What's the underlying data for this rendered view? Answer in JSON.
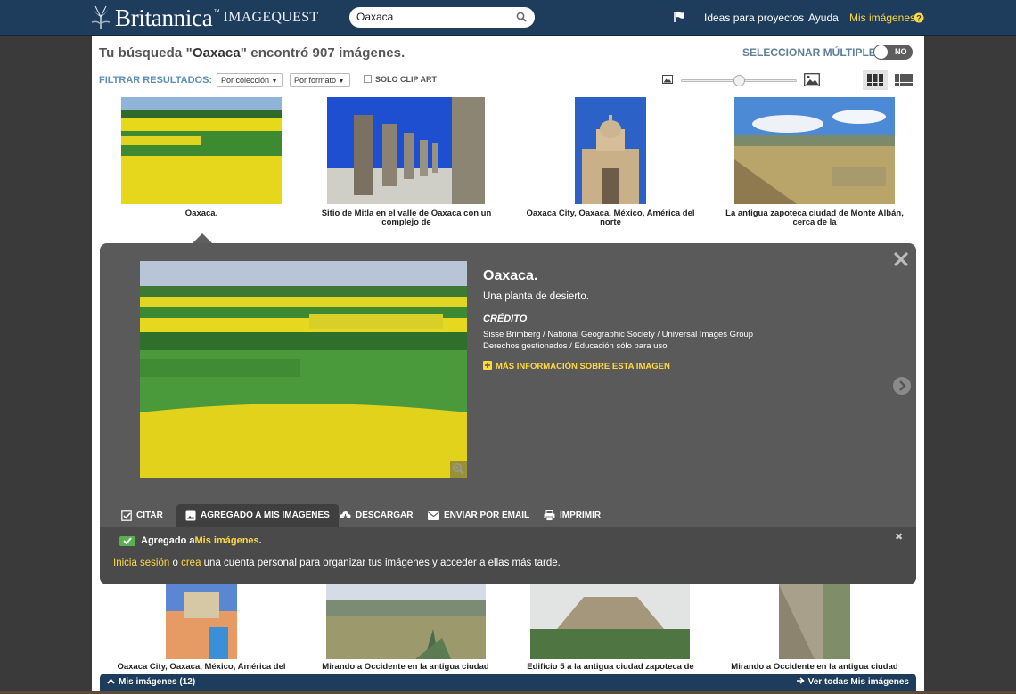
{
  "header": {
    "brand": "Britannica",
    "product": "IMAGEQUEST",
    "tm": "™",
    "search_value": "Oaxaca",
    "nav": [
      "Ideas para proyectos",
      "Ayuda",
      "Mis imágenes"
    ],
    "accent": "#ffd83f",
    "bar_color": "#1e3c5b"
  },
  "results": {
    "prefix": "Tu búsqueda \"",
    "query": "Oaxaca",
    "suffix": "\" encontró 907 imágenes.",
    "multi_label": "SELECCIONAR MÚLTIPLES",
    "toggle_label": "NO"
  },
  "filters": {
    "label": "FILTRAR RESULTADOS:",
    "collection": "Por colección",
    "format": "Por formato",
    "clipart": "SOLO CLIP ART"
  },
  "thumbs_top": [
    {
      "caption": "Oaxaca."
    },
    {
      "caption": "Sitio de Mitla en el valle de Oaxaca con un complejo de"
    },
    {
      "caption": "Oaxaca City, Oaxaca, México, América del norte"
    },
    {
      "caption": "La antigua zapoteca ciudad de Monte Albán, cerca de la"
    }
  ],
  "thumbs_bottom": [
    {
      "caption": "Oaxaca City, Oaxaca, México, América del"
    },
    {
      "caption": "Mirando a Occidente en la antigua ciudad"
    },
    {
      "caption": "Edificio 5 a la antigua ciudad zapoteca de"
    },
    {
      "caption": "Mirando a Occidente en la antigua ciudad"
    }
  ],
  "detail": {
    "title": "Oaxaca.",
    "description": "Una planta de desierto.",
    "credit_label": "CRÉDITO",
    "credit_line1": "Sisse Brimberg / National Geographic Society / Universal Images Group",
    "credit_line2": "Derechos gestionados / Educación sólo para uso",
    "more_info": "MÁS INFORMACIÓN SOBRE ESTA IMAGEN"
  },
  "tabs": [
    "CITAR",
    "AGREGADO A MIS IMÁGENES",
    "DESCARGAR",
    "ENVIAR POR EMAIL",
    "IMPRIMIR"
  ],
  "drawer": {
    "added_prefix": "Agregado a ",
    "added_link": "Mis imágenes",
    "added_suffix": ".",
    "login_link": "Inicia sesión",
    "or": " o ",
    "create_link": "crea",
    "rest": " una cuenta personal para organizar tus imágenes y acceder a ellas más tarde."
  },
  "bottombar": {
    "left": "Mis imágenes (12)",
    "right": "Ver todas Mis imágenes"
  }
}
